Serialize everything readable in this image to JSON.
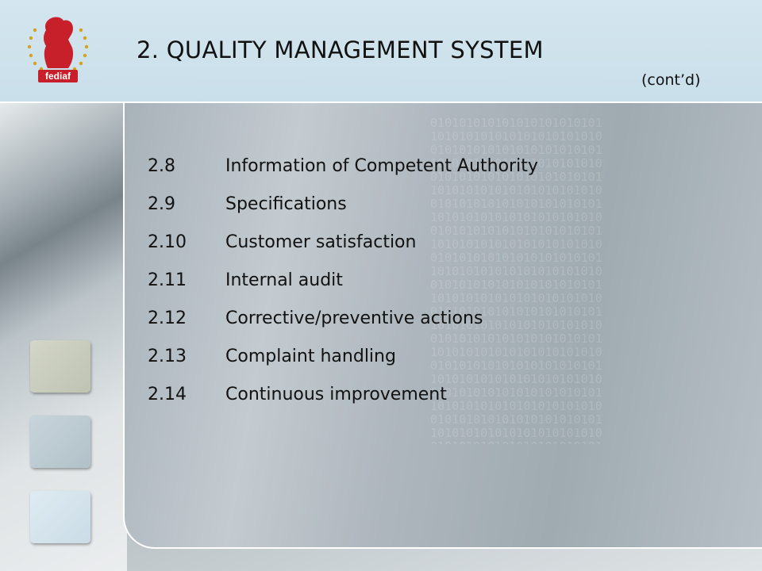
{
  "header": {
    "title": "2. QUALITY MANAGEMENT SYSTEM",
    "subtitle": "(cont’d)",
    "logo_text": "fediaf"
  },
  "items": [
    {
      "num": "2.8",
      "text": "Information of Competent Authority"
    },
    {
      "num": "2.9",
      "text": "Specifications"
    },
    {
      "num": "2.10",
      "text": "Customer satisfaction"
    },
    {
      "num": "2.11",
      "text": "Internal audit"
    },
    {
      "num": "2.12",
      "text": "Corrective/preventive actions"
    },
    {
      "num": "2.13",
      "text": "Complaint handling"
    },
    {
      "num": "2.14",
      "text": "Continuous improvement"
    }
  ],
  "colors": {
    "header_bg": "#cfe3ec",
    "logo_red": "#c8202a",
    "star_gold": "#d4a21c",
    "square_1": "#c9cdbd",
    "square_2": "#bccbd3",
    "square_3": "#d6e6ef"
  }
}
